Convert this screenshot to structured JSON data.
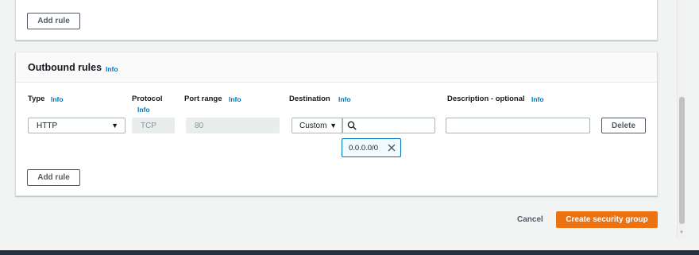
{
  "top_panel": {
    "add_rule_label": "Add rule"
  },
  "outbound": {
    "title": "Outbound rules",
    "title_info": "Info",
    "columns": {
      "type": "Type",
      "type_info": "Info",
      "protocol": "Protocol",
      "protocol_info": "Info",
      "port_range": "Port range",
      "port_range_info": "Info",
      "destination": "Destination",
      "destination_info": "Info",
      "description": "Description - optional",
      "description_info": "Info"
    },
    "row": {
      "type_value": "HTTP",
      "protocol_value": "TCP",
      "port_value": "80",
      "destination_mode": "Custom",
      "destination_search": "",
      "description_value": "",
      "delete_label": "Delete",
      "token": "0.0.0.0/0"
    },
    "add_rule_label": "Add rule"
  },
  "footer": {
    "cancel_label": "Cancel",
    "create_label": "Create security group"
  },
  "colors": {
    "primary": "#ec7211",
    "link": "#0073bb",
    "header_dark": "#232f3e"
  },
  "icons": [
    "caret-down-icon",
    "search-icon",
    "close-icon"
  ]
}
